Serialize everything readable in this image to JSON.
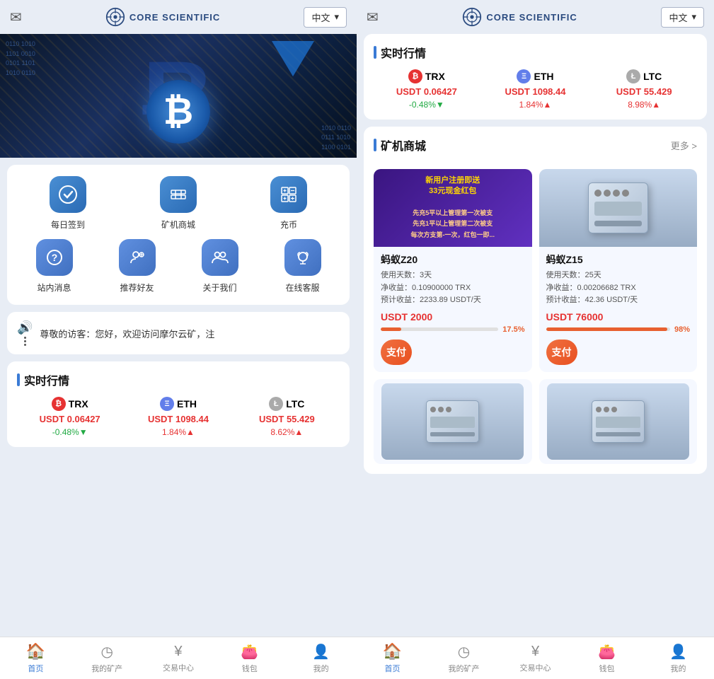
{
  "app": {
    "title": "CORE SCIENTIFIC",
    "lang": "中文"
  },
  "left_panel": {
    "header": {
      "mail_icon": "✉",
      "lang_label": "中文"
    },
    "quick_actions": {
      "row1": [
        {
          "id": "daily-sign",
          "label": "每日签到",
          "icon": "⚙"
        },
        {
          "id": "miner-shop",
          "label": "矿机商城",
          "icon": "⊞"
        },
        {
          "id": "recharge",
          "label": "充币",
          "icon": "⊞"
        }
      ],
      "row2": [
        {
          "id": "messages",
          "label": "站内消息",
          "icon": "?"
        },
        {
          "id": "refer-friend",
          "label": "推荐好友",
          "icon": "👤"
        },
        {
          "id": "about-us",
          "label": "关于我们",
          "icon": "👥"
        },
        {
          "id": "online-service",
          "label": "在线客服",
          "icon": "🎧"
        }
      ]
    },
    "announcement": {
      "text": "尊敬的访客：您好，欢迎访问摩尔云矿，注"
    },
    "market": {
      "title": "实时行情",
      "coins": [
        {
          "id": "trx",
          "name": "TRX",
          "icon_class": "trx",
          "icon_text": "₿",
          "price": "USDT 0.06427",
          "change": "-0.48%▼",
          "change_class": "down"
        },
        {
          "id": "eth",
          "name": "ETH",
          "icon_class": "eth",
          "icon_text": "Ξ",
          "price": "USDT 1098.44",
          "change": "1.84%▲",
          "change_class": "up"
        },
        {
          "id": "ltc",
          "name": "LTC",
          "icon_class": "ltc",
          "icon_text": "Ł",
          "price": "USDT 55.429",
          "change": "8.62%▲",
          "change_class": "up"
        }
      ]
    },
    "bottom_nav": [
      {
        "id": "home",
        "label": "首页",
        "icon": "🏠",
        "active": true
      },
      {
        "id": "my-mining",
        "label": "我的矿产",
        "icon": "◷",
        "active": false
      },
      {
        "id": "trade",
        "label": "交易中心",
        "icon": "¥",
        "active": false
      },
      {
        "id": "wallet",
        "label": "钱包",
        "icon": "👛",
        "active": false
      },
      {
        "id": "mine",
        "label": "我的",
        "icon": "👤",
        "active": false
      }
    ]
  },
  "right_panel": {
    "header": {
      "mail_icon": "✉",
      "lang_label": "中文"
    },
    "market": {
      "title": "实时行情",
      "coins": [
        {
          "id": "trx",
          "name": "TRX",
          "icon_class": "trx",
          "icon_text": "₿",
          "price": "USDT 0.06427",
          "change": "-0.48%▼",
          "change_class": "down"
        },
        {
          "id": "eth",
          "name": "ETH",
          "icon_class": "eth",
          "icon_text": "Ξ",
          "price": "USDT 1098.44",
          "change": "1.84%▲",
          "change_class": "up"
        },
        {
          "id": "ltc",
          "name": "LTC",
          "icon_class": "ltc",
          "icon_text": "Ł",
          "price": "USDT 55.429",
          "change": "8.98%▲",
          "change_class": "up"
        }
      ]
    },
    "miner_shop": {
      "title": "矿机商城",
      "more_label": "更多 >",
      "miners": [
        {
          "id": "z20",
          "name": "蚂蚁Z20",
          "type": "promo",
          "promo_text": "新用户注册即送\n33元现金红包",
          "days": "3",
          "net_profit": "0.10900000 TRX",
          "est_profit": "2233.89 USDT/天",
          "price": "USDT 2000",
          "progress": 17.5,
          "progress_label": "17.5%",
          "pay_label": "支付"
        },
        {
          "id": "z15",
          "name": "蚂蚁Z15",
          "type": "machine",
          "days": "25",
          "net_profit": "0.00206682 TRX",
          "est_profit": "42.36 USDT/天",
          "price": "USDT 76000",
          "progress": 98,
          "progress_label": "98%",
          "pay_label": "支付"
        }
      ]
    },
    "bottom_nav": [
      {
        "id": "home",
        "label": "首页",
        "icon": "🏠",
        "active": true
      },
      {
        "id": "my-mining",
        "label": "我的矿产",
        "icon": "◷",
        "active": false
      },
      {
        "id": "trade",
        "label": "交易中心",
        "icon": "¥",
        "active": false
      },
      {
        "id": "wallet",
        "label": "钱包",
        "icon": "👛",
        "active": false
      },
      {
        "id": "mine",
        "label": "我的",
        "icon": "👤",
        "active": false
      }
    ]
  }
}
